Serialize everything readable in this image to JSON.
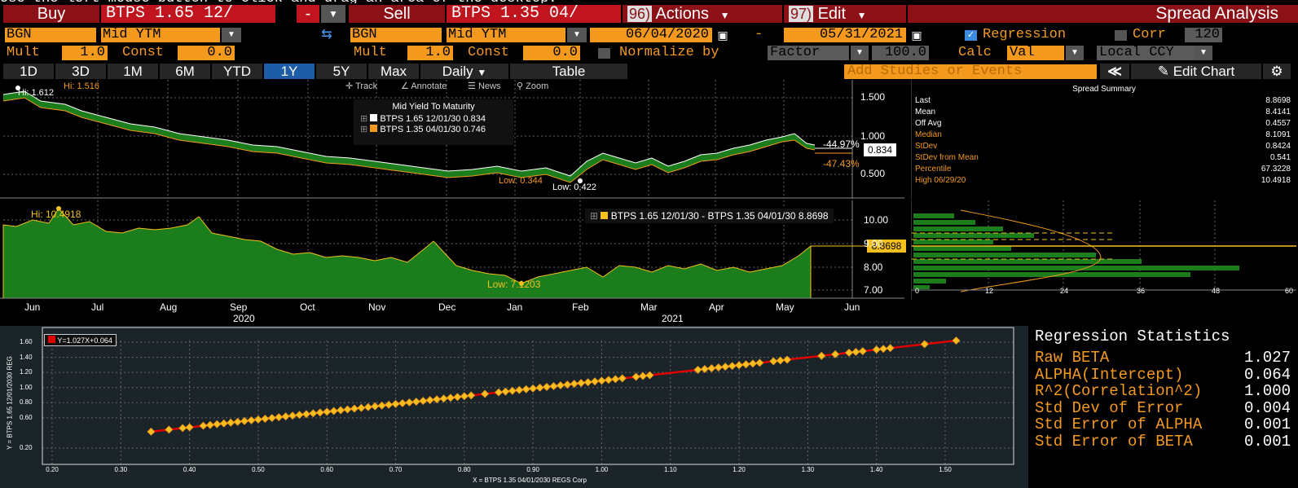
{
  "top_hint": "Use the left mouse button to click and drag an area of the desktop.",
  "header": {
    "buy_label": "Buy",
    "buy_security": "BTPS 1.65 12/",
    "dash": "-",
    "sell_label": "Sell",
    "sell_security": "BTPS 1.35 04/",
    "actions_num": "96)",
    "actions_label": "Actions",
    "edit_num": "97)",
    "edit_label": "Edit",
    "title": "Spread Analysis"
  },
  "row2": {
    "buy_source": "BGN",
    "buy_field": "Mid YTM",
    "sell_source": "BGN",
    "sell_field": "Mid YTM",
    "start_date": "06/04/2020",
    "date_sep": "-",
    "end_date": "05/31/2021",
    "regression_label": "Regression",
    "corr_label": "Corr",
    "corr_value": "120"
  },
  "row3": {
    "mult_label": "Mult",
    "mult1": "1.0",
    "const_label": "Const",
    "const1": "0.0",
    "mult2": "1.0",
    "const2": "0.0",
    "normalize_label": "Normalize by",
    "normalize_value": "Factor",
    "normalize_num": "100.0",
    "calc_label": "Calc",
    "calc_value": "Val",
    "ccy_value": "Local CCY"
  },
  "row4": {
    "tabs": [
      "1D",
      "3D",
      "1M",
      "6M",
      "YTD",
      "1Y",
      "5Y",
      "Max"
    ],
    "selected_tab": "1Y",
    "daily_label": "Daily",
    "table_label": "Table",
    "studies_placeholder": "Add Studies or Events",
    "edit_chart_label": "Edit Chart"
  },
  "toolbar": {
    "track": "Track",
    "annotate": "Annotate",
    "news": "News",
    "zoom": "Zoom"
  },
  "top_chart": {
    "hi_white": "Hi: 1.612",
    "hi_orange": "Hi: 1.516",
    "low_orange": "Low: 0.344",
    "low_white": "Low: 0.422",
    "legend_title": "Mid Yield To Maturity",
    "legend": [
      {
        "name": "BTPS 1.65 12/01/30",
        "value": "0.834",
        "color": "#ffffff"
      },
      {
        "name": "BTPS 1.35 04/01/30",
        "value": "0.746",
        "color": "#f39a1e"
      }
    ],
    "pct_white": "-44.97%",
    "pct_orange": "-47.43%",
    "last_white": "0.834",
    "yticks": [
      "1.500",
      "1.000",
      "0.500"
    ]
  },
  "mid_chart": {
    "hi": "Hi: 10.4918",
    "low": "Low: 7.1203",
    "legend": "BTPS 1.65 12/01/30 - BTPS 1.35 04/01/30 8.8698",
    "last": "8.8698",
    "yticks": [
      "10.00",
      "9.00",
      "8.00",
      "7.00"
    ],
    "xticks": [
      "Jun",
      "Jul",
      "Aug",
      "Sep",
      "Oct",
      "Nov",
      "Dec",
      "Jan",
      "Feb",
      "Mar",
      "Apr",
      "May",
      "Jun"
    ],
    "years": [
      "2020",
      "2021"
    ]
  },
  "spread_summary": {
    "title": "Spread Summary",
    "rows": [
      {
        "k": "Last",
        "v": "8.8698",
        "color": "#ffffff"
      },
      {
        "k": "Mean",
        "v": "8.4141",
        "color": "#ffffff"
      },
      {
        "k": "Off Avg",
        "v": "0.4557",
        "color": "#ffffff"
      },
      {
        "k": "Median",
        "v": "8.1091",
        "color": "#f39a1e"
      },
      {
        "k": "StDev",
        "v": "0.8424",
        "color": "#f39a1e"
      },
      {
        "k": "StDev from Mean",
        "v": "0.541",
        "color": "#f39a1e"
      },
      {
        "k": "Percentile",
        "v": "67.3228",
        "color": "#f39a1e"
      },
      {
        "k": "High 06/29/20",
        "v": "10.4918",
        "color": "#f39a1e"
      }
    ]
  },
  "histogram": {
    "xticks": [
      "0",
      "12",
      "24",
      "36",
      "48",
      "60"
    ]
  },
  "scatter": {
    "equation": "Y=1.027X+0.064",
    "ylabel": "Y = BTPS 1.65 12/01/2030 REG",
    "xlabel": "X = BTPS 1.35 04/01/2030 REGS Corp",
    "xticks": [
      "0.20",
      "0.30",
      "0.40",
      "0.50",
      "0.60",
      "0.70",
      "0.80",
      "0.90",
      "1.00",
      "1.10",
      "1.20",
      "1.30",
      "1.40",
      "1.50"
    ],
    "yticks": [
      "1.60",
      "1.40",
      "1.20",
      "1.00",
      "0.80",
      "0.60",
      "0.20"
    ]
  },
  "regression": {
    "title": "Regression Statistics",
    "rows": [
      {
        "k": "Raw BETA",
        "v": "1.027"
      },
      {
        "k": "ALPHA(Intercept)",
        "v": "0.064"
      },
      {
        "k": "R^2(Correlation^2)",
        "v": "1.000"
      },
      {
        "k": "Std Dev of Error",
        "v": "0.004"
      },
      {
        "k": "Std Error of ALPHA",
        "v": "0.001"
      },
      {
        "k": "Std Error of BETA",
        "v": "0.001"
      }
    ]
  },
  "colors": {
    "orange": "#f39a1e",
    "green": "#1b7d1b",
    "red": "#c0141e",
    "blue": "#1e5ca8"
  }
}
